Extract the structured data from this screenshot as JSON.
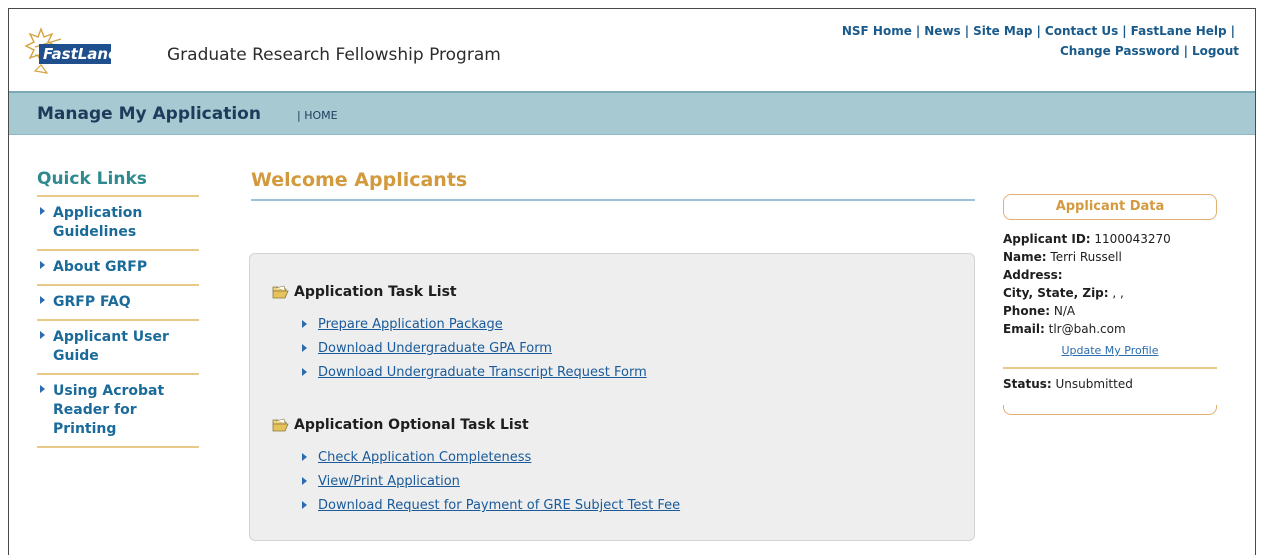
{
  "header": {
    "logo_text": "FastLane",
    "program_title": "Graduate Research Fellowship Program",
    "links_row1": [
      "NSF Home",
      "News",
      "Site Map",
      "Contact Us",
      "FastLane Help"
    ],
    "links_row2": [
      "Change Password",
      "Logout"
    ]
  },
  "banner": {
    "title": "Manage My Application",
    "crumb": "| HOME"
  },
  "quick_links": {
    "title": "Quick Links",
    "items": [
      {
        "label": "Application\nGuidelines"
      },
      {
        "label": "About GRFP"
      },
      {
        "label": "GRFP FAQ"
      },
      {
        "label": "Applicant User\nGuide"
      },
      {
        "label": "Using Acrobat\nReader for\nPrinting"
      }
    ]
  },
  "main": {
    "welcome": "Welcome Applicants",
    "task_list": {
      "title": "Application Task List",
      "items": [
        "Prepare Application Package",
        "Download Undergraduate GPA Form",
        "Download Undergraduate Transcript Request Form"
      ]
    },
    "optional_task_list": {
      "title": "Application Optional Task List",
      "items": [
        "Check Application Completeness",
        "View/Print Application",
        "Download Request for Payment of GRE Subject Test Fee"
      ]
    }
  },
  "applicant": {
    "title": "Applicant Data",
    "id_label": "Applicant ID:",
    "id_value": " 1100043270",
    "name_label": "Name:",
    "name_value": " Terri Russell",
    "address_label": "Address:",
    "address_value": "",
    "city_label": "City, State, Zip:",
    "city_value": " , ,",
    "phone_label": "Phone:",
    "phone_value": " N/A",
    "email_label": "Email:",
    "email_value": " tlr@bah.com",
    "update_link": "Update My Profile",
    "status_label": "Status:",
    "status_value": " Unsubmitted"
  },
  "colors": {
    "banner_bg": "#a7cad2",
    "link_blue": "#1a5a9a",
    "accent_gold": "#d29a3c",
    "quick_links_teal": "#2f8a8f"
  }
}
